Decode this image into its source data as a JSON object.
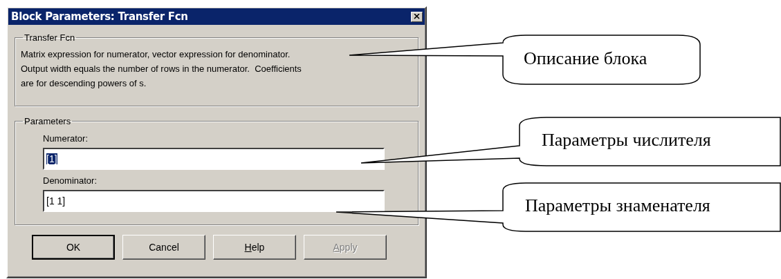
{
  "window": {
    "title": "Block Parameters: Transfer Fcn"
  },
  "description_group": {
    "title": "Transfer Fcn",
    "text": "Matrix expression for numerator, vector expression for denominator.\nOutput width equals the number of rows in the numerator.  Coefficients\nare for descending powers of s."
  },
  "parameters_group": {
    "title": "Parameters",
    "fields": [
      {
        "label": "Numerator:",
        "value": "[1]",
        "highlighted": true
      },
      {
        "label": "Denominator:",
        "value": "[1 1]",
        "highlighted": false
      }
    ]
  },
  "buttons": [
    {
      "label": "OK",
      "default": true,
      "disabled": false,
      "underlined_first_letter": false
    },
    {
      "label": "Cancel",
      "default": false,
      "disabled": false,
      "underlined_first_letter": false
    },
    {
      "label": "Help",
      "default": false,
      "disabled": false,
      "underlined_first_letter": true
    },
    {
      "label": "Apply",
      "default": false,
      "disabled": true,
      "underlined_first_letter": true
    }
  ],
  "callouts": [
    {
      "text": "Описание блока"
    },
    {
      "text": "Параметры числителя"
    },
    {
      "text": "Параметры знаменателя"
    }
  ]
}
